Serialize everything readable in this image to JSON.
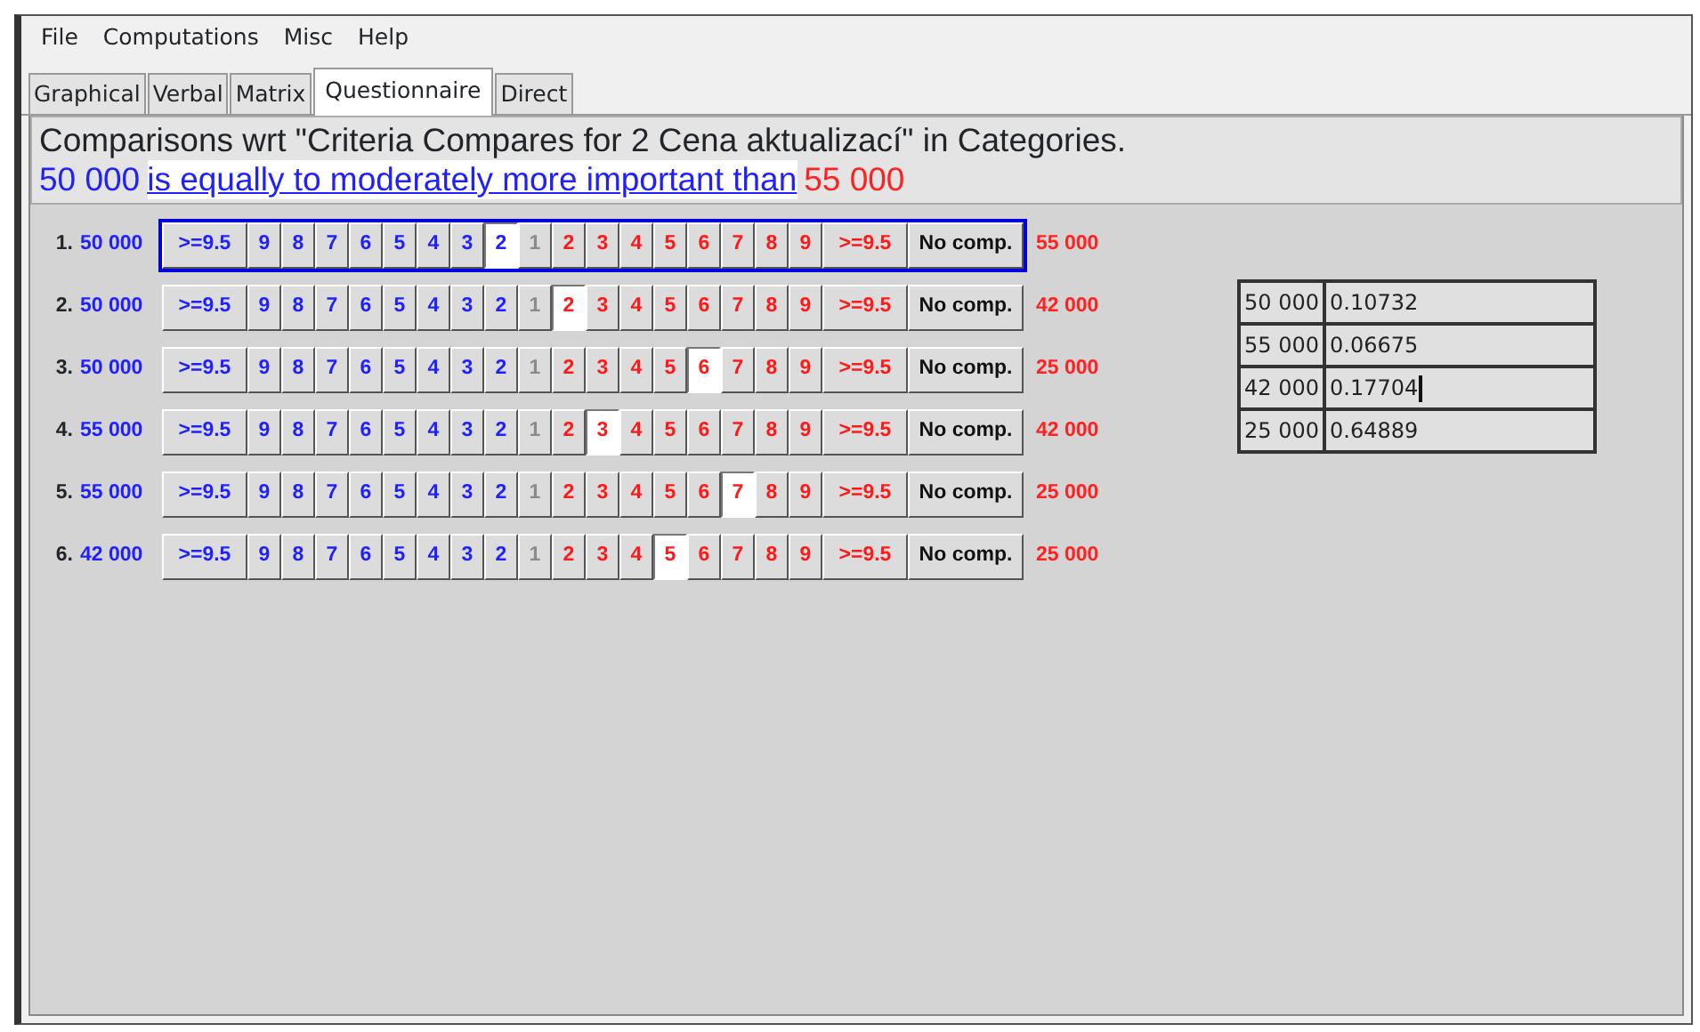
{
  "menu": [
    "File",
    "Computations",
    "Misc",
    "Help"
  ],
  "tabs": [
    {
      "label": "Graphical",
      "selected": false
    },
    {
      "label": "Verbal",
      "selected": false
    },
    {
      "label": "Matrix",
      "selected": false
    },
    {
      "label": "Questionnaire",
      "selected": true
    },
    {
      "label": "Direct",
      "selected": false
    }
  ],
  "header": {
    "title": "Comparisons wrt \"Criteria Compares for 2 Cena aktualizací\" in Categories.",
    "left": "50 000",
    "phrase": "is equally to moderately more important than",
    "right": "55 000"
  },
  "comparisons": [
    {
      "number": "1.",
      "left": "50 000",
      "right": "55 000",
      "focused": true,
      "buttons": [
        {
          "label": ">=9.5",
          "kind": "left",
          "selected": false
        },
        {
          "label": "9",
          "kind": "left",
          "selected": false
        },
        {
          "label": "8",
          "kind": "left",
          "selected": false
        },
        {
          "label": "7",
          "kind": "left",
          "selected": false
        },
        {
          "label": "6",
          "kind": "left",
          "selected": false
        },
        {
          "label": "5",
          "kind": "left",
          "selected": false
        },
        {
          "label": "4",
          "kind": "left",
          "selected": false
        },
        {
          "label": "3",
          "kind": "left",
          "selected": false
        },
        {
          "label": "2",
          "kind": "left",
          "selected": true
        },
        {
          "label": "1",
          "kind": "equal",
          "selected": false
        },
        {
          "label": "2",
          "kind": "right",
          "selected": false
        },
        {
          "label": "3",
          "kind": "right",
          "selected": false
        },
        {
          "label": "4",
          "kind": "right",
          "selected": false
        },
        {
          "label": "5",
          "kind": "right",
          "selected": false
        },
        {
          "label": "6",
          "kind": "right",
          "selected": false
        },
        {
          "label": "7",
          "kind": "right",
          "selected": false
        },
        {
          "label": "8",
          "kind": "right",
          "selected": false
        },
        {
          "label": "9",
          "kind": "right",
          "selected": false
        },
        {
          "label": ">=9.5",
          "kind": "right",
          "selected": false
        },
        {
          "label": "No comp.",
          "kind": "none",
          "selected": false
        }
      ]
    },
    {
      "number": "2.",
      "left": "50 000",
      "right": "42 000",
      "focused": false,
      "buttons": [
        {
          "label": ">=9.5",
          "kind": "left",
          "selected": false
        },
        {
          "label": "9",
          "kind": "left",
          "selected": false
        },
        {
          "label": "8",
          "kind": "left",
          "selected": false
        },
        {
          "label": "7",
          "kind": "left",
          "selected": false
        },
        {
          "label": "6",
          "kind": "left",
          "selected": false
        },
        {
          "label": "5",
          "kind": "left",
          "selected": false
        },
        {
          "label": "4",
          "kind": "left",
          "selected": false
        },
        {
          "label": "3",
          "kind": "left",
          "selected": false
        },
        {
          "label": "2",
          "kind": "left",
          "selected": false
        },
        {
          "label": "1",
          "kind": "equal",
          "selected": false
        },
        {
          "label": "2",
          "kind": "right",
          "selected": true
        },
        {
          "label": "3",
          "kind": "right",
          "selected": false
        },
        {
          "label": "4",
          "kind": "right",
          "selected": false
        },
        {
          "label": "5",
          "kind": "right",
          "selected": false
        },
        {
          "label": "6",
          "kind": "right",
          "selected": false
        },
        {
          "label": "7",
          "kind": "right",
          "selected": false
        },
        {
          "label": "8",
          "kind": "right",
          "selected": false
        },
        {
          "label": "9",
          "kind": "right",
          "selected": false
        },
        {
          "label": ">=9.5",
          "kind": "right",
          "selected": false
        },
        {
          "label": "No comp.",
          "kind": "none",
          "selected": false
        }
      ]
    },
    {
      "number": "3.",
      "left": "50 000",
      "right": "25 000",
      "focused": false,
      "buttons": [
        {
          "label": ">=9.5",
          "kind": "left",
          "selected": false
        },
        {
          "label": "9",
          "kind": "left",
          "selected": false
        },
        {
          "label": "8",
          "kind": "left",
          "selected": false
        },
        {
          "label": "7",
          "kind": "left",
          "selected": false
        },
        {
          "label": "6",
          "kind": "left",
          "selected": false
        },
        {
          "label": "5",
          "kind": "left",
          "selected": false
        },
        {
          "label": "4",
          "kind": "left",
          "selected": false
        },
        {
          "label": "3",
          "kind": "left",
          "selected": false
        },
        {
          "label": "2",
          "kind": "left",
          "selected": false
        },
        {
          "label": "1",
          "kind": "equal",
          "selected": false
        },
        {
          "label": "2",
          "kind": "right",
          "selected": false
        },
        {
          "label": "3",
          "kind": "right",
          "selected": false
        },
        {
          "label": "4",
          "kind": "right",
          "selected": false
        },
        {
          "label": "5",
          "kind": "right",
          "selected": false
        },
        {
          "label": "6",
          "kind": "right",
          "selected": true
        },
        {
          "label": "7",
          "kind": "right",
          "selected": false
        },
        {
          "label": "8",
          "kind": "right",
          "selected": false
        },
        {
          "label": "9",
          "kind": "right",
          "selected": false
        },
        {
          "label": ">=9.5",
          "kind": "right",
          "selected": false
        },
        {
          "label": "No comp.",
          "kind": "none",
          "selected": false
        }
      ]
    },
    {
      "number": "4.",
      "left": "55 000",
      "right": "42 000",
      "focused": false,
      "buttons": [
        {
          "label": ">=9.5",
          "kind": "left",
          "selected": false
        },
        {
          "label": "9",
          "kind": "left",
          "selected": false
        },
        {
          "label": "8",
          "kind": "left",
          "selected": false
        },
        {
          "label": "7",
          "kind": "left",
          "selected": false
        },
        {
          "label": "6",
          "kind": "left",
          "selected": false
        },
        {
          "label": "5",
          "kind": "left",
          "selected": false
        },
        {
          "label": "4",
          "kind": "left",
          "selected": false
        },
        {
          "label": "3",
          "kind": "left",
          "selected": false
        },
        {
          "label": "2",
          "kind": "left",
          "selected": false
        },
        {
          "label": "1",
          "kind": "equal",
          "selected": false
        },
        {
          "label": "2",
          "kind": "right",
          "selected": false
        },
        {
          "label": "3",
          "kind": "right",
          "selected": true
        },
        {
          "label": "4",
          "kind": "right",
          "selected": false
        },
        {
          "label": "5",
          "kind": "right",
          "selected": false
        },
        {
          "label": "6",
          "kind": "right",
          "selected": false
        },
        {
          "label": "7",
          "kind": "right",
          "selected": false
        },
        {
          "label": "8",
          "kind": "right",
          "selected": false
        },
        {
          "label": "9",
          "kind": "right",
          "selected": false
        },
        {
          "label": ">=9.5",
          "kind": "right",
          "selected": false
        },
        {
          "label": "No comp.",
          "kind": "none",
          "selected": false
        }
      ]
    },
    {
      "number": "5.",
      "left": "55 000",
      "right": "25 000",
      "focused": false,
      "buttons": [
        {
          "label": ">=9.5",
          "kind": "left",
          "selected": false
        },
        {
          "label": "9",
          "kind": "left",
          "selected": false
        },
        {
          "label": "8",
          "kind": "left",
          "selected": false
        },
        {
          "label": "7",
          "kind": "left",
          "selected": false
        },
        {
          "label": "6",
          "kind": "left",
          "selected": false
        },
        {
          "label": "5",
          "kind": "left",
          "selected": false
        },
        {
          "label": "4",
          "kind": "left",
          "selected": false
        },
        {
          "label": "3",
          "kind": "left",
          "selected": false
        },
        {
          "label": "2",
          "kind": "left",
          "selected": false
        },
        {
          "label": "1",
          "kind": "equal",
          "selected": false
        },
        {
          "label": "2",
          "kind": "right",
          "selected": false
        },
        {
          "label": "3",
          "kind": "right",
          "selected": false
        },
        {
          "label": "4",
          "kind": "right",
          "selected": false
        },
        {
          "label": "5",
          "kind": "right",
          "selected": false
        },
        {
          "label": "6",
          "kind": "right",
          "selected": false
        },
        {
          "label": "7",
          "kind": "right",
          "selected": true
        },
        {
          "label": "8",
          "kind": "right",
          "selected": false
        },
        {
          "label": "9",
          "kind": "right",
          "selected": false
        },
        {
          "label": ">=9.5",
          "kind": "right",
          "selected": false
        },
        {
          "label": "No comp.",
          "kind": "none",
          "selected": false
        }
      ]
    },
    {
      "number": "6.",
      "left": "42 000",
      "right": "25 000",
      "focused": false,
      "buttons": [
        {
          "label": ">=9.5",
          "kind": "left",
          "selected": false
        },
        {
          "label": "9",
          "kind": "left",
          "selected": false
        },
        {
          "label": "8",
          "kind": "left",
          "selected": false
        },
        {
          "label": "7",
          "kind": "left",
          "selected": false
        },
        {
          "label": "6",
          "kind": "left",
          "selected": false
        },
        {
          "label": "5",
          "kind": "left",
          "selected": false
        },
        {
          "label": "4",
          "kind": "left",
          "selected": false
        },
        {
          "label": "3",
          "kind": "left",
          "selected": false
        },
        {
          "label": "2",
          "kind": "left",
          "selected": false
        },
        {
          "label": "1",
          "kind": "equal",
          "selected": false
        },
        {
          "label": "2",
          "kind": "right",
          "selected": false
        },
        {
          "label": "3",
          "kind": "right",
          "selected": false
        },
        {
          "label": "4",
          "kind": "right",
          "selected": false
        },
        {
          "label": "5",
          "kind": "right",
          "selected": true
        },
        {
          "label": "6",
          "kind": "right",
          "selected": false
        },
        {
          "label": "7",
          "kind": "right",
          "selected": false
        },
        {
          "label": "8",
          "kind": "right",
          "selected": false
        },
        {
          "label": "9",
          "kind": "right",
          "selected": false
        },
        {
          "label": ">=9.5",
          "kind": "right",
          "selected": false
        },
        {
          "label": "No comp.",
          "kind": "none",
          "selected": false
        }
      ]
    }
  ],
  "priorities": [
    {
      "name": "50 000",
      "value": "0.10732",
      "editing": false
    },
    {
      "name": "55 000",
      "value": "0.06675",
      "editing": false
    },
    {
      "name": "42 000",
      "value": "0.17704",
      "editing": true
    },
    {
      "name": "25 000",
      "value": "0.64889",
      "editing": false
    }
  ]
}
